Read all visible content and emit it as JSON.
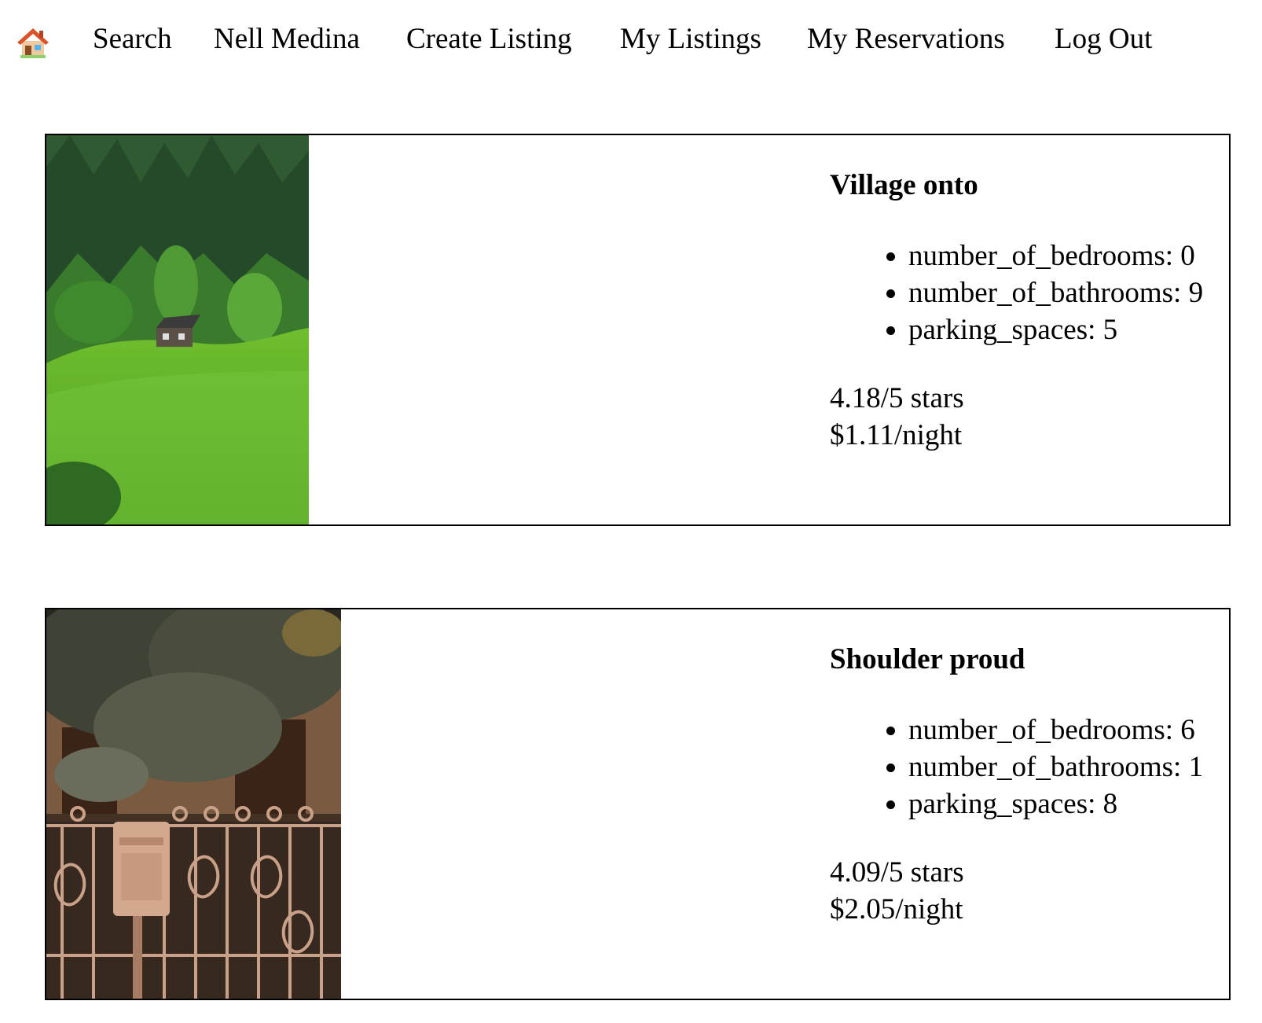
{
  "nav": {
    "home_icon": "house-emoji-icon",
    "links": [
      {
        "label": "Search"
      },
      {
        "label": "Nell Medina"
      },
      {
        "label": "Create Listing"
      },
      {
        "label": "My Listings"
      },
      {
        "label": "My Reservations"
      },
      {
        "label": "Log Out"
      }
    ]
  },
  "listings": [
    {
      "title": "Village onto",
      "features": [
        "number_of_bedrooms: 0",
        "number_of_bathrooms: 9",
        "parking_spaces: 5"
      ],
      "rating": "4.18/5 stars",
      "price": "$1.11/night"
    },
    {
      "title": "Shoulder proud",
      "features": [
        "number_of_bedrooms: 6",
        "number_of_bathrooms: 1",
        "parking_spaces: 8"
      ],
      "rating": "4.09/5 stars",
      "price": "$2.05/night"
    }
  ]
}
